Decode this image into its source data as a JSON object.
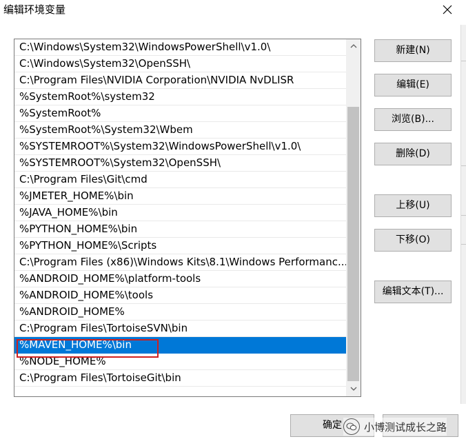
{
  "window": {
    "title": "编辑环境变量"
  },
  "paths": [
    "C:\\Windows\\System32\\WindowsPowerShell\\v1.0\\",
    "C:\\Windows\\System32\\OpenSSH\\",
    "C:\\Program Files\\NVIDIA Corporation\\NVIDIA NvDLISR",
    "%SystemRoot%\\system32",
    "%SystemRoot%",
    "%SystemRoot%\\System32\\Wbem",
    "%SYSTEMROOT%\\System32\\WindowsPowerShell\\v1.0\\",
    "%SYSTEMROOT%\\System32\\OpenSSH\\",
    "C:\\Program Files\\Git\\cmd",
    "%JMETER_HOME%\\bin",
    "%JAVA_HOME%\\bin",
    "%PYTHON_HOME%\\bin",
    "%PYTHON_HOME%\\Scripts",
    "C:\\Program Files (x86)\\Windows Kits\\8.1\\Windows Performanc...",
    "%ANDROID_HOME%\\platform-tools",
    "%ANDROID_HOME%\\tools",
    "%ANDROID_HOME%",
    "C:\\Program Files\\TortoiseSVN\\bin",
    "%MAVEN_HOME%\\bin",
    "%NODE_HOME%",
    "C:\\Program Files\\TortoiseGit\\bin"
  ],
  "selected_index": 18,
  "buttons": {
    "new": "新建(N)",
    "edit": "编辑(E)",
    "browse": "浏览(B)...",
    "delete": "删除(D)",
    "move_up": "上移(U)",
    "move_down": "下移(O)",
    "edit_text": "编辑文本(T)...",
    "ok": "确定"
  },
  "watermark": {
    "text": "小博测试成长之路"
  },
  "colors": {
    "selection": "#0078d7",
    "highlight_border": "#d0201e",
    "button_bg": "#e1e1e1"
  }
}
